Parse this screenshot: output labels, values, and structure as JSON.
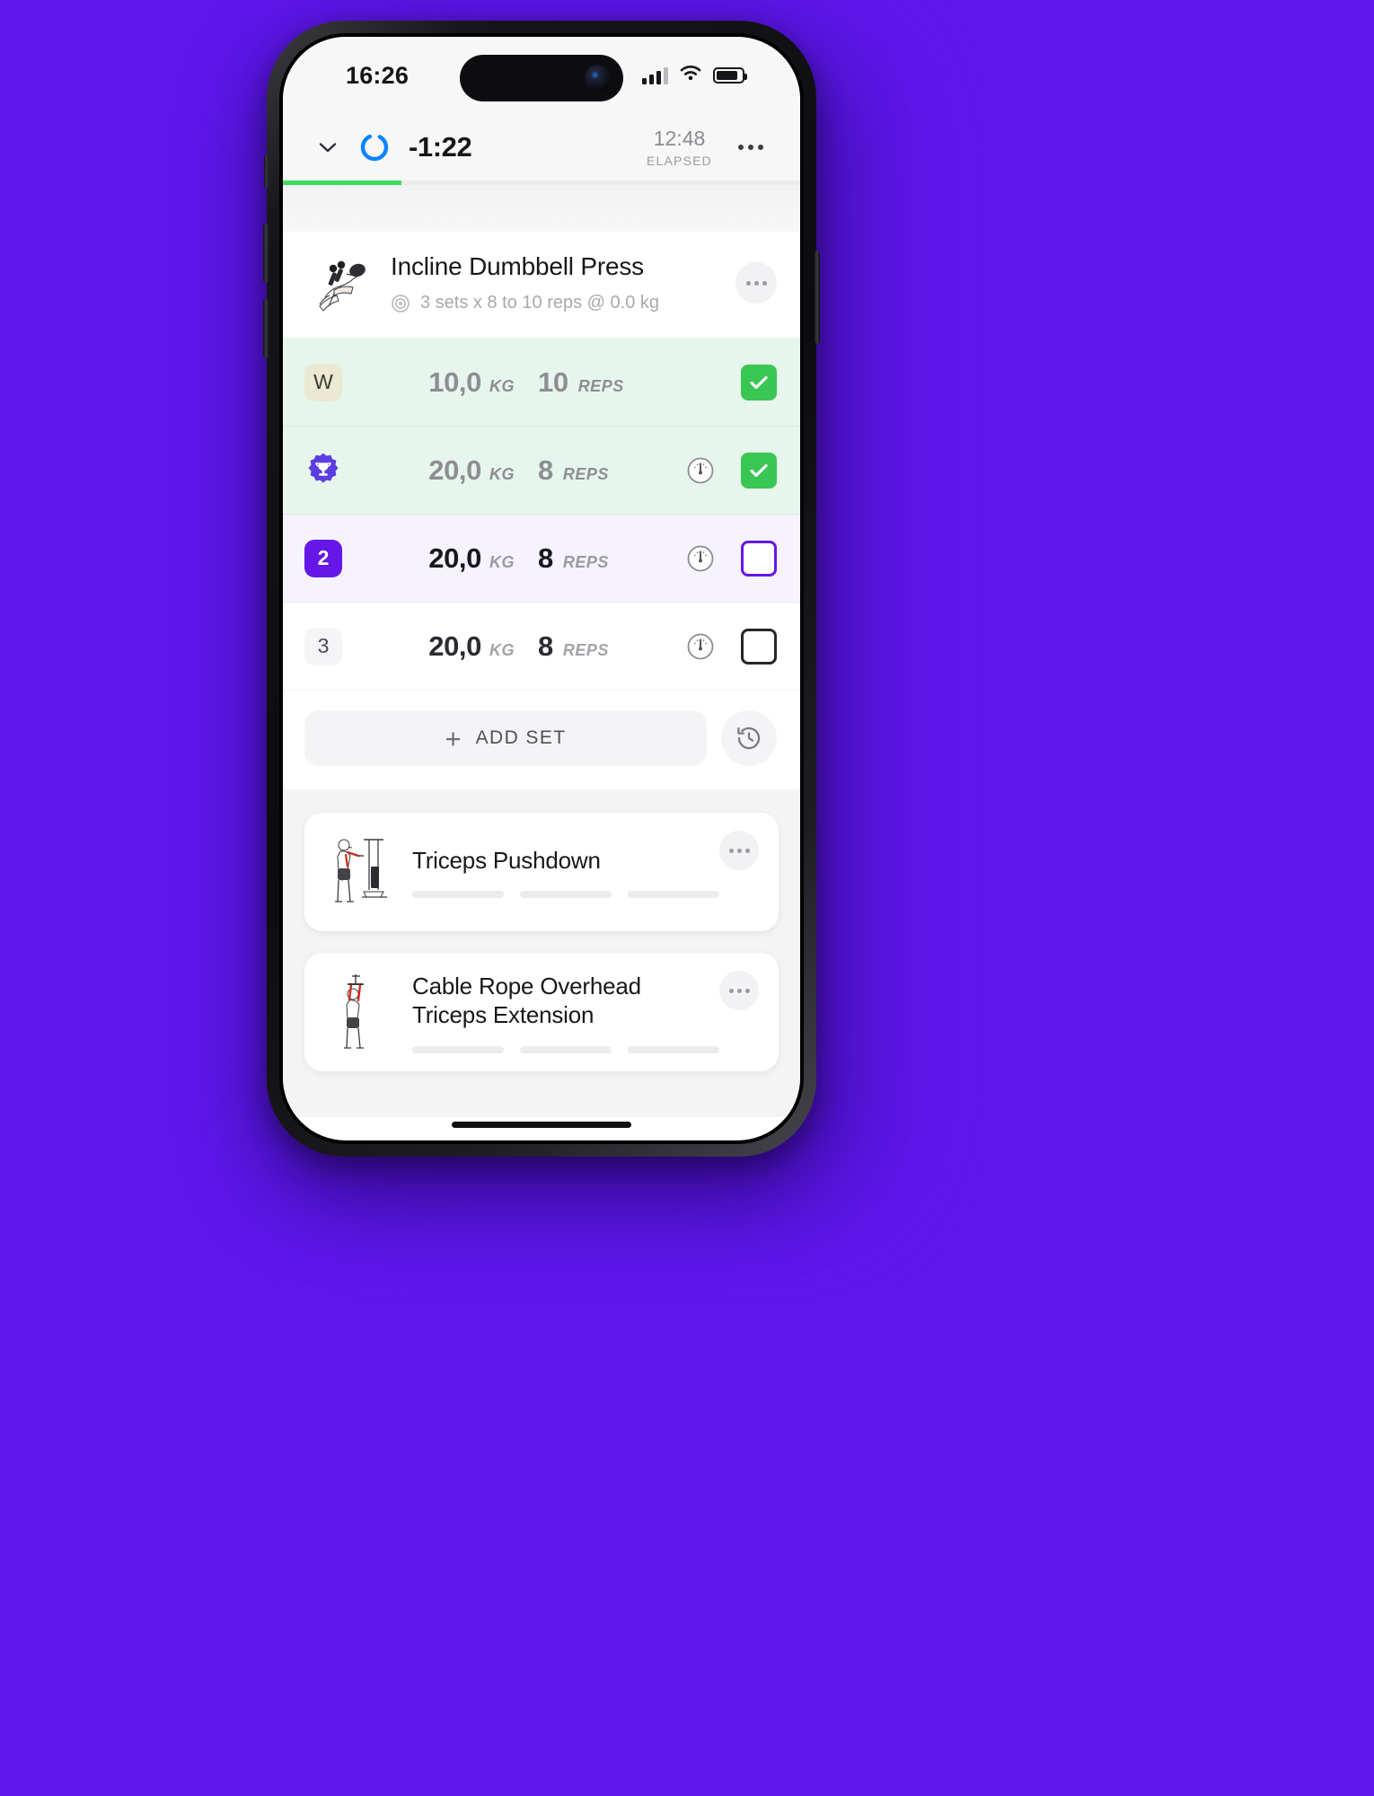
{
  "status_bar": {
    "time": "16:26",
    "signal_icon": "cellular-signal-icon",
    "wifi_icon": "wifi-icon",
    "battery_icon": "battery-icon"
  },
  "header": {
    "collapse_icon": "chevron-down-icon",
    "rest_timer_icon": "timer-ring-icon",
    "rest_timer": "-1:22",
    "elapsed_value": "12:48",
    "elapsed_label": "ELAPSED",
    "more_icon": "more-horizontal-icon",
    "progress_percent": 23,
    "progress_color": "#3ddc5d",
    "accent_color": "#6417e6",
    "timer_color": "#0a84ff"
  },
  "active_exercise": {
    "thumb_icon": "incline-dumbbell-press-illustration",
    "title": "Incline Dumbbell Press",
    "target_icon": "target-icon",
    "summary": "3 sets x 8 to 10 reps @ 0.0 kg",
    "menu_icon": "more-horizontal-icon",
    "columns": {
      "weight_unit": "KG",
      "reps_unit": "REPS"
    },
    "sets": [
      {
        "badge": "W",
        "badge_kind": "warmup",
        "weight": "10,0",
        "weight_unit": "KG",
        "reps": "10",
        "reps_unit": "REPS",
        "gauge_icon": null,
        "state": "done",
        "check_icon": "check-icon"
      },
      {
        "badge": "",
        "badge_kind": "personal-record",
        "badge_icon": "trophy-badge-icon",
        "weight": "20,0",
        "weight_unit": "KG",
        "reps": "8",
        "reps_unit": "REPS",
        "gauge_icon": "rpe-gauge-icon",
        "state": "done",
        "check_icon": "check-icon"
      },
      {
        "badge": "2",
        "badge_kind": "current",
        "weight": "20,0",
        "weight_unit": "KG",
        "reps": "8",
        "reps_unit": "REPS",
        "gauge_icon": "rpe-gauge-icon",
        "state": "active",
        "check_icon": null
      },
      {
        "badge": "3",
        "badge_kind": "pending",
        "weight": "20,0",
        "weight_unit": "KG",
        "reps": "8",
        "reps_unit": "REPS",
        "gauge_icon": "rpe-gauge-icon",
        "state": "pending",
        "check_icon": null
      }
    ],
    "add_set_label": "ADD SET",
    "add_set_icon": "plus-icon",
    "history_icon": "history-clock-icon"
  },
  "upcoming_exercises": [
    {
      "thumb_icon": "triceps-pushdown-illustration",
      "title": "Triceps Pushdown",
      "menu_icon": "more-horizontal-icon"
    },
    {
      "thumb_icon": "cable-rope-overhead-triceps-extension-illustration",
      "title": "Cable Rope Overhead Triceps Extension",
      "menu_icon": "more-horizontal-icon"
    }
  ],
  "home_indicator": "home-indicator"
}
